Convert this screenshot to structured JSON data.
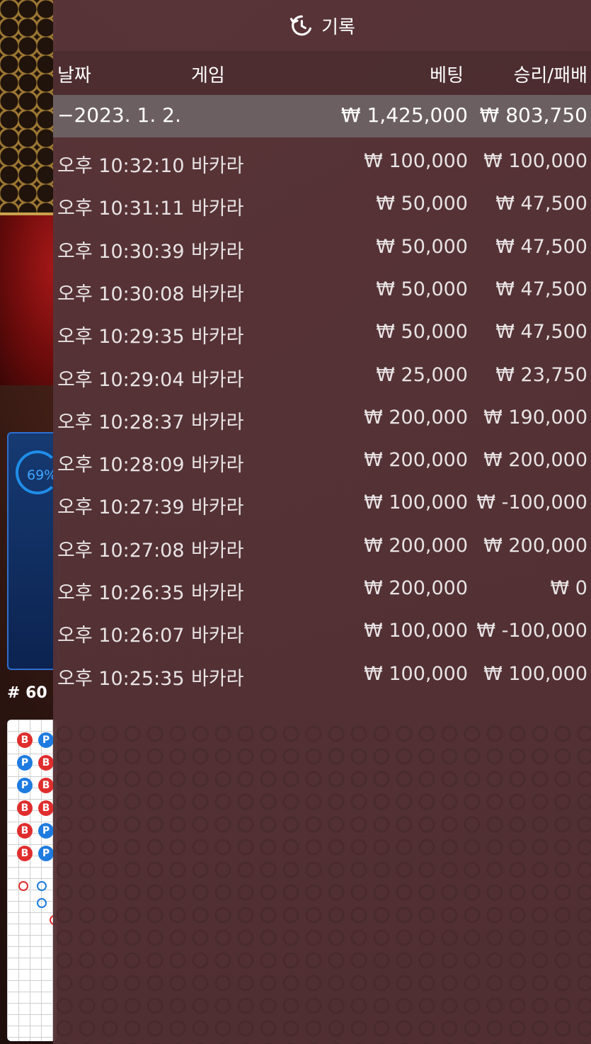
{
  "background": {
    "progress_percent": "69%",
    "round_number": "# 60",
    "bead_road": [
      [
        "B",
        "P"
      ],
      [
        "P",
        "B"
      ],
      [
        "P",
        "B"
      ],
      [
        "B",
        "B"
      ],
      [
        "B",
        "P"
      ],
      [
        "B",
        "P"
      ]
    ]
  },
  "history": {
    "title": "기록",
    "title_icon": "history-icon",
    "columns": {
      "date": "날짜",
      "game": "게임",
      "bet": "베팅",
      "result": "승리/패배"
    },
    "date_group": {
      "date": "−2023. 1. 2.",
      "bet_total": "₩ 1,425,000",
      "result_total": "₩ 803,750"
    },
    "rows": [
      {
        "time": "오후 10:32:10",
        "game": "바카라",
        "bet": "₩ 100,000",
        "result": "₩ 100,000"
      },
      {
        "time": "오후 10:31:11",
        "game": "바카라",
        "bet": "₩ 50,000",
        "result": "₩ 47,500"
      },
      {
        "time": "오후 10:30:39",
        "game": "바카라",
        "bet": "₩ 50,000",
        "result": "₩ 47,500"
      },
      {
        "time": "오후 10:30:08",
        "game": "바카라",
        "bet": "₩ 50,000",
        "result": "₩ 47,500"
      },
      {
        "time": "오후 10:29:35",
        "game": "바카라",
        "bet": "₩ 50,000",
        "result": "₩ 47,500"
      },
      {
        "time": "오후 10:29:04",
        "game": "바카라",
        "bet": "₩ 25,000",
        "result": "₩ 23,750"
      },
      {
        "time": "오후 10:28:37",
        "game": "바카라",
        "bet": "₩ 200,000",
        "result": "₩ 190,000"
      },
      {
        "time": "오후 10:28:09",
        "game": "바카라",
        "bet": "₩ 200,000",
        "result": "₩ 200,000"
      },
      {
        "time": "오후 10:27:39",
        "game": "바카라",
        "bet": "₩ 100,000",
        "result": "₩ -100,000"
      },
      {
        "time": "오후 10:27:08",
        "game": "바카라",
        "bet": "₩ 200,000",
        "result": "₩ 200,000"
      },
      {
        "time": "오후 10:26:35",
        "game": "바카라",
        "bet": "₩ 200,000",
        "result": "₩ 0"
      },
      {
        "time": "오후 10:26:07",
        "game": "바카라",
        "bet": "₩ 100,000",
        "result": "₩ -100,000"
      },
      {
        "time": "오후 10:25:35",
        "game": "바카라",
        "bet": "₩ 100,000",
        "result": "₩ 100,000"
      }
    ]
  }
}
